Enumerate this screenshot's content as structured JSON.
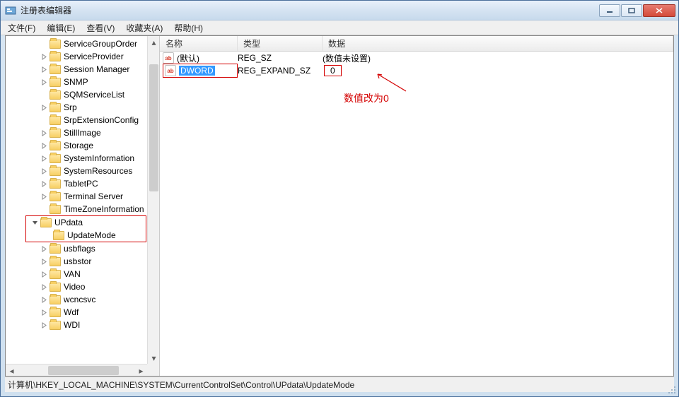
{
  "window": {
    "title": "注册表编辑器"
  },
  "menu": {
    "file": "文件(F)",
    "edit": "编辑(E)",
    "view": "查看(V)",
    "favorites": "收藏夹(A)",
    "help": "帮助(H)"
  },
  "tree": {
    "nodes": [
      "ServiceGroupOrder",
      "ServiceProvider",
      "Session Manager",
      "SNMP",
      "SQMServiceList",
      "Srp",
      "SrpExtensionConfig",
      "StillImage",
      "Storage",
      "SystemInformation",
      "SystemResources",
      "TabletPC",
      "Terminal Server",
      "TimeZoneInformation",
      "UPdata",
      "UpdateMode",
      "usbflags",
      "usbstor",
      "VAN",
      "Video",
      "wcncsvc",
      "Wdf",
      "WDI"
    ]
  },
  "list": {
    "headers": {
      "name": "名称",
      "type": "类型",
      "data": "数据"
    },
    "rows": [
      {
        "name": "(默认)",
        "type": "REG_SZ",
        "data": "(数值未设置)"
      },
      {
        "name": "DWORD",
        "type": "REG_EXPAND_SZ",
        "data": "0"
      }
    ]
  },
  "annotation": {
    "text": "数值改为0"
  },
  "statusbar": {
    "path": "计算机\\HKEY_LOCAL_MACHINE\\SYSTEM\\CurrentControlSet\\Control\\UPdata\\UpdateMode"
  }
}
